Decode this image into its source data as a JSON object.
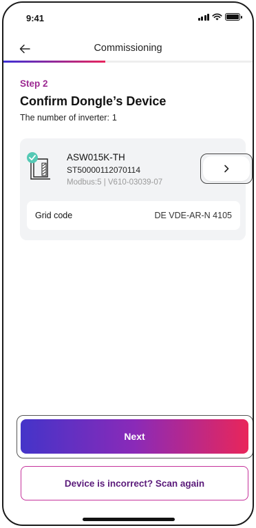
{
  "status_bar": {
    "time": "9:41"
  },
  "header": {
    "title": "Commissioning"
  },
  "progress": {
    "fraction": 0.41
  },
  "content": {
    "step_label": "Step 2",
    "title": "Confirm Dongle’s Device",
    "inverter_count_label": "The number of inverter:",
    "inverter_count": "1"
  },
  "device": {
    "model": "ASW015K-TH",
    "serial": "ST50000112070114",
    "meta": "Modbus:5 | V610-03039-07",
    "status_color": "#55c9b5"
  },
  "grid_code": {
    "label": "Grid code",
    "value": "DE VDE-AR-N 4105"
  },
  "actions": {
    "next_label": "Next",
    "scan_again_label": "Device is incorrect? Scan again"
  },
  "icons": {
    "back": "arrow-left-icon",
    "detail": "chevron-right-icon",
    "device": "inverter-device-icon",
    "check": "check-icon"
  },
  "colors": {
    "accent_purple": "#9c2891",
    "gradient_start": "#4434c9",
    "gradient_end": "#e9265a"
  }
}
